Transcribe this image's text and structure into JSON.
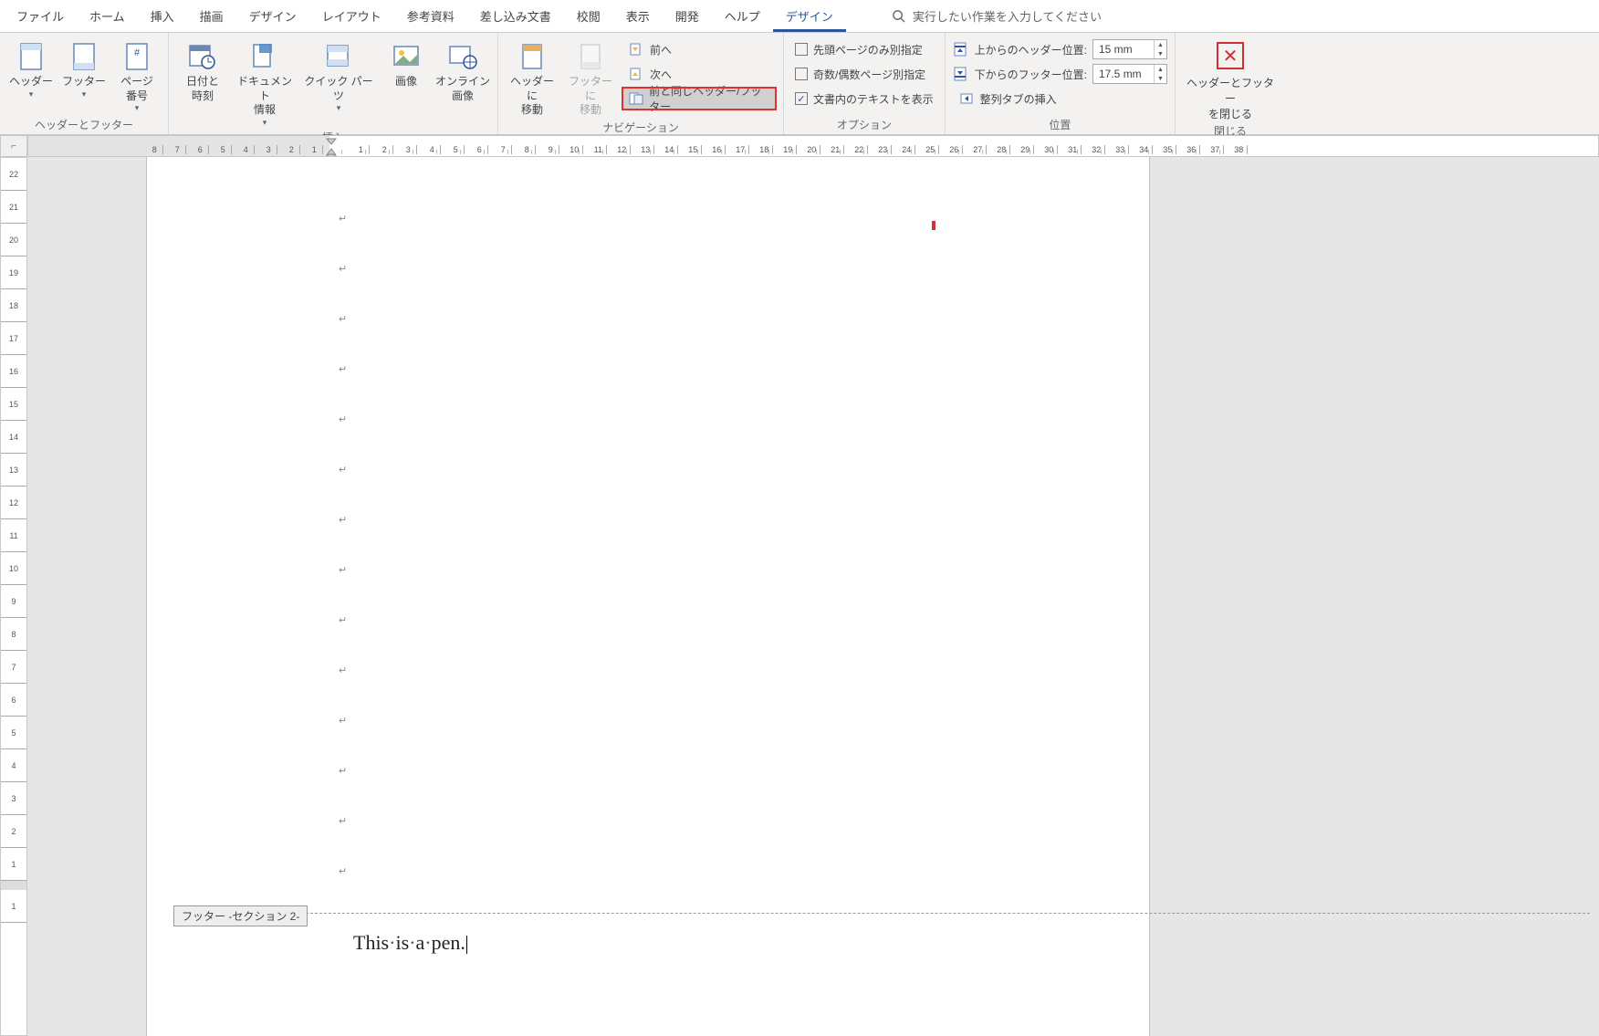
{
  "menu": {
    "tabs": [
      "ファイル",
      "ホーム",
      "挿入",
      "描画",
      "デザイン",
      "レイアウト",
      "参考資料",
      "差し込み文書",
      "校閲",
      "表示",
      "開発",
      "ヘルプ",
      "デザイン"
    ],
    "active_index": 12,
    "search_placeholder": "実行したい作業を入力してください"
  },
  "ribbon": {
    "groups": {
      "header_footer": {
        "label": "ヘッダーとフッター",
        "buttons": {
          "header": "ヘッダー",
          "footer": "フッター",
          "page_number": "ページ\n番号"
        }
      },
      "insert": {
        "label": "挿入",
        "buttons": {
          "date_time": "日付と\n時刻",
          "doc_info": "ドキュメント\n情報",
          "quick_parts": "クイック パーツ",
          "picture": "画像",
          "online_picture": "オンライン\n画像"
        }
      },
      "navigation": {
        "label": "ナビゲーション",
        "goto_header": "ヘッダーに\n移動",
        "goto_footer": "フッターに\n移動",
        "prev": "前へ",
        "next": "次へ",
        "link_previous": "前と同じヘッダー/フッター"
      },
      "options": {
        "label": "オプション",
        "diff_first": "先頭ページのみ別指定",
        "diff_odd_even": "奇数/偶数ページ別指定",
        "show_text": "文書内のテキストを表示",
        "show_text_checked": true
      },
      "position": {
        "label": "位置",
        "header_from_top_label": "上からのヘッダー位置:",
        "header_from_top_value": "15 mm",
        "footer_from_bottom_label": "下からのフッター位置:",
        "footer_from_bottom_value": "17.5 mm",
        "align_tab": "整列タブの挿入"
      },
      "close": {
        "label": "閉じる",
        "button": "ヘッダーとフッター\nを閉じる"
      }
    }
  },
  "ruler": {
    "h_left_labels": [
      "8",
      "7",
      "6",
      "5",
      "4",
      "3",
      "2",
      "1"
    ],
    "h_right_count": 38,
    "v_top_labels": [
      "22",
      "21",
      "20",
      "19",
      "18",
      "17",
      "16",
      "15",
      "14",
      "13",
      "12",
      "11",
      "10",
      "9",
      "8",
      "7",
      "6",
      "5",
      "4",
      "3",
      "2",
      "1"
    ],
    "v_bottom_labels": [
      "1"
    ]
  },
  "document": {
    "footer_tab_label": "フッター  -セクション 2-",
    "footer_text_parts": [
      "This",
      "is",
      "a",
      "pen."
    ]
  }
}
